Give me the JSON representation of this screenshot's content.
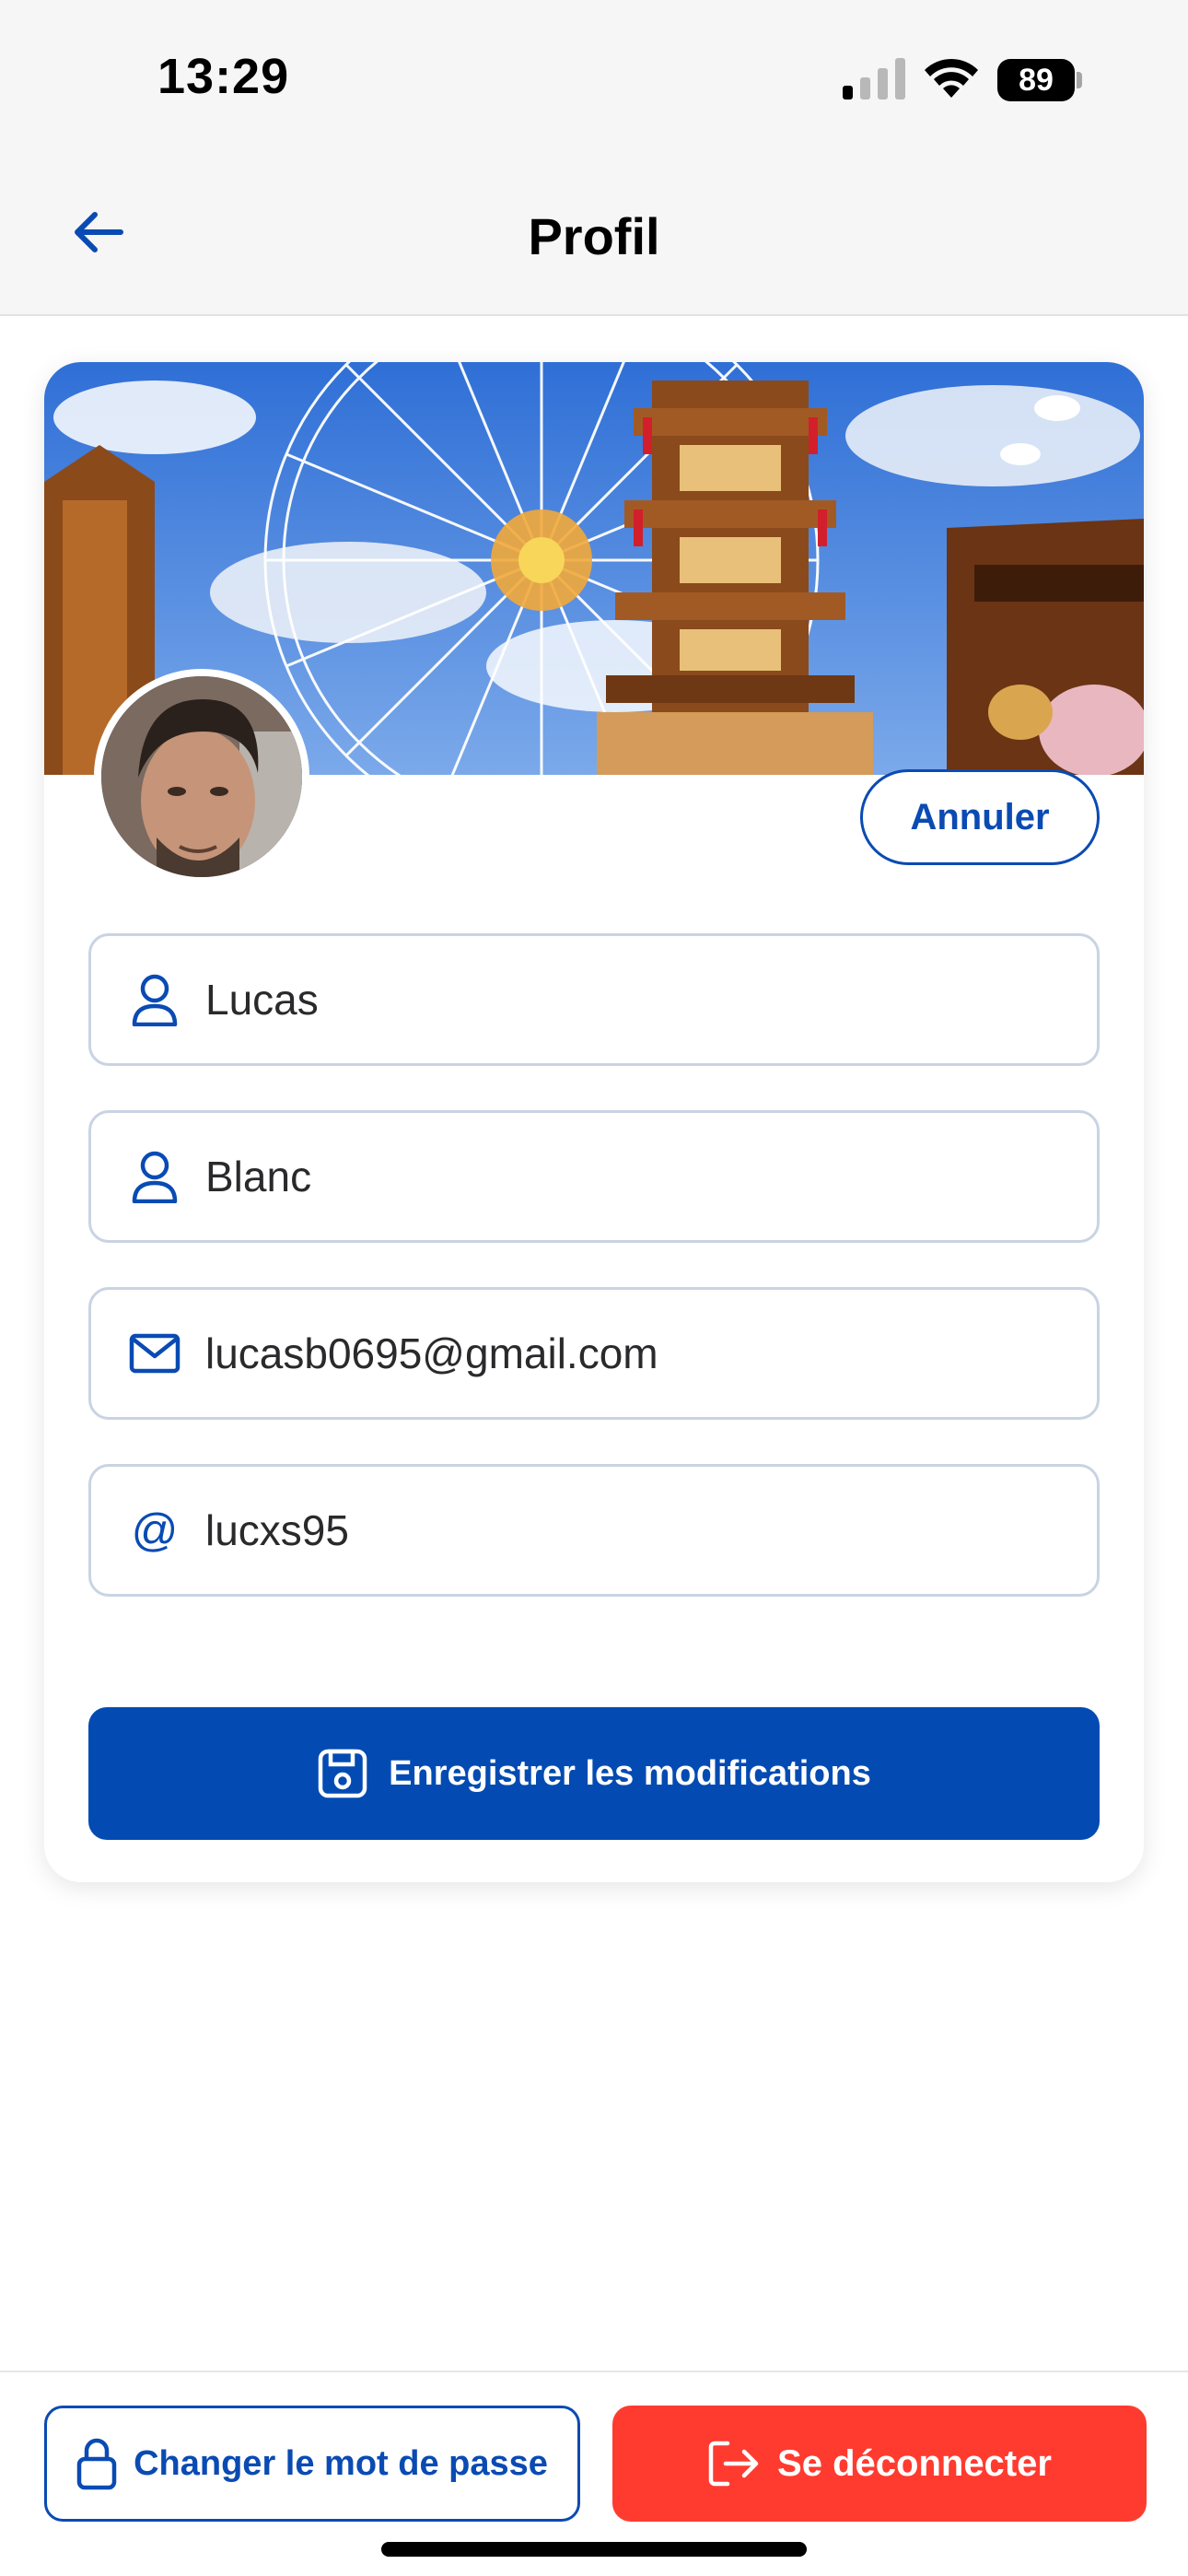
{
  "status_bar": {
    "time": "13:29",
    "battery": "89",
    "icons": [
      "cellular-signal-icon",
      "wifi-icon",
      "battery-icon"
    ]
  },
  "header": {
    "title": "Profil",
    "back_icon": "arrow-left-icon"
  },
  "profile": {
    "cancel_label": "Annuler",
    "fields": [
      {
        "icon": "user-icon",
        "value": "Lucas"
      },
      {
        "icon": "user-icon",
        "value": "Blanc"
      },
      {
        "icon": "mail-icon",
        "value": "lucasb0695@gmail.com"
      },
      {
        "icon": "at-icon",
        "value": "lucxs95"
      }
    ],
    "save_label": "Enregistrer les modifications",
    "save_icon": "floppy-disk-icon"
  },
  "footer": {
    "change_password_label": "Changer le mot de passe",
    "change_password_icon": "lock-icon",
    "logout_label": "Se déconnecter",
    "logout_icon": "logout-icon"
  },
  "colors": {
    "primary": "#034bb2",
    "danger": "#ff3b30",
    "field_border": "#c9d3e3",
    "header_bg": "#f6f6f6"
  }
}
